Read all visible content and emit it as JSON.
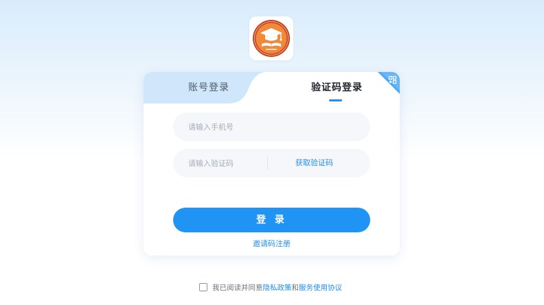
{
  "logo": {
    "icon": "graduation-cap-emblem-icon",
    "outer_color": "#c9421f",
    "inner_color": "#f08a3a",
    "cap_color": "#ffffff"
  },
  "tabs": {
    "account_label": "账号登录",
    "code_label": "验证码登录",
    "active": "code_label",
    "qr_icon": "qr-code-icon"
  },
  "form": {
    "phone_placeholder": "请输入手机号",
    "phone_value": "",
    "code_placeholder": "请输入验证码",
    "code_value": "",
    "get_code_label": "获取验证码"
  },
  "login_button_label": "登 录",
  "invite_register_label": "邀请码注册",
  "agreement": {
    "checked": false,
    "prefix": "我已阅读并同意",
    "privacy_label": "隐私政策",
    "and": "和",
    "terms_label": "服务使用协议"
  },
  "colors": {
    "accent": "#1f8ff2",
    "button": "#1f94f5",
    "tab_inactive_bg": "#cfe6fb"
  }
}
